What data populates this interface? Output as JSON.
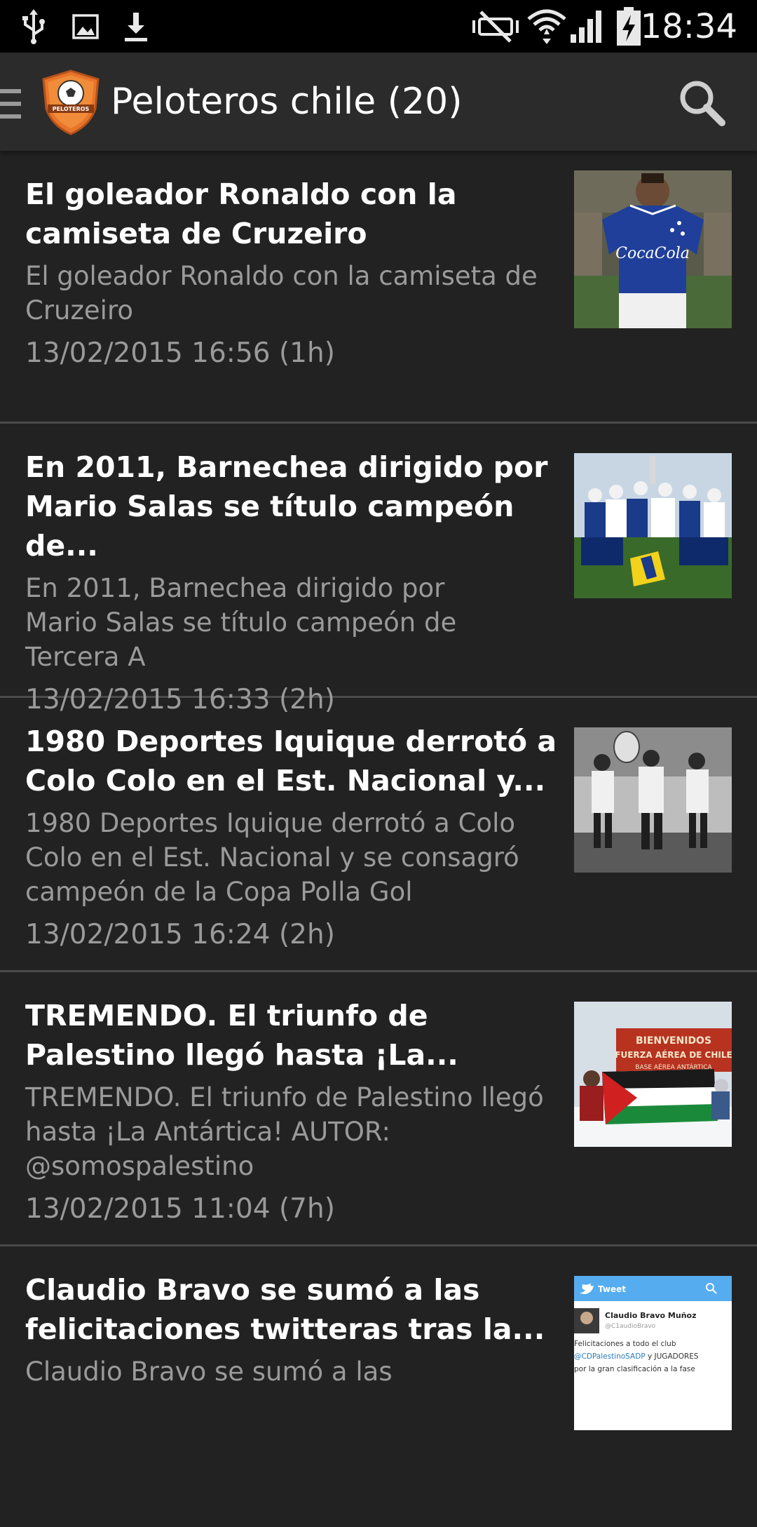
{
  "status_bar": {
    "time": "18:34",
    "left_icons": [
      "usb-icon",
      "image-icon",
      "download-icon"
    ],
    "right_icons": [
      "mute-icon",
      "wifi-icon",
      "signal-icon",
      "battery-charging-icon"
    ]
  },
  "action_bar": {
    "title": "Peloteros chile (20)",
    "logo_text": "PELOTEROS",
    "icons": [
      "drawer-icon",
      "app-logo",
      "search-icon"
    ]
  },
  "feed": [
    {
      "title": "El goleador Ronaldo con la camiseta de Cruzeiro",
      "description": "El goleador Ronaldo con la camiseta de Cruzeiro",
      "timestamp": "13/02/2015 16:56 (1h)",
      "thumbnail": {
        "shirt_text": "CocaCola"
      }
    },
    {
      "title": "En 2011, Barnechea dirigido por Mario Salas se título campeón de...",
      "description": "En 2011, Barnechea dirigido por Mario Salas se título campeón de Tercera A",
      "timestamp": "13/02/2015 16:33 (2h)",
      "thumbnail": {}
    },
    {
      "title": "1980 Deportes Iquique derrotó a Colo Colo en el Est. Nacional y...",
      "description": "1980 Deportes Iquique derrotó a Colo Colo en el Est. Nacional y se consagró campeón de la Copa Polla Gol",
      "timestamp": "13/02/2015 16:24 (2h)",
      "thumbnail": {}
    },
    {
      "title": "TREMENDO. El triunfo de Palestino llegó hasta ¡La...",
      "description": "TREMENDO. El triunfo de Palestino llegó hasta ¡La Antártica! AUTOR: @somospalestino",
      "timestamp": "13/02/2015 11:04 (7h)",
      "thumbnail": {
        "sign_line1": "BIENVENIDOS",
        "sign_line2": "FUERZA AÉREA DE CHILE",
        "sign_line3": "BASE AÉREA ANTÁRTICA"
      }
    },
    {
      "title": "Claudio Bravo se sumó a las felicitaciones twitteras tras la...",
      "description": "Claudio Bravo se sumó a las",
      "timestamp": "",
      "thumbnail": {
        "header_label": "Tweet",
        "user_name": "Claudio Bravo Muñoz",
        "user_handle": "@C1audioBravo",
        "tweet_line1": "Felicitaciones a todo el club",
        "tweet_mention": "@CDPalestinoSADP",
        "tweet_line2_rest": " y JUGADORES",
        "tweet_line3": "por la gran clasificación a la fase"
      }
    }
  ],
  "colors": {
    "background": "#222222",
    "action_bar": "#2b2b2b",
    "status_bar": "#000000",
    "title_text": "#ffffff",
    "secondary_text": "#9a9a9a",
    "divider": "#4a4a4a"
  }
}
